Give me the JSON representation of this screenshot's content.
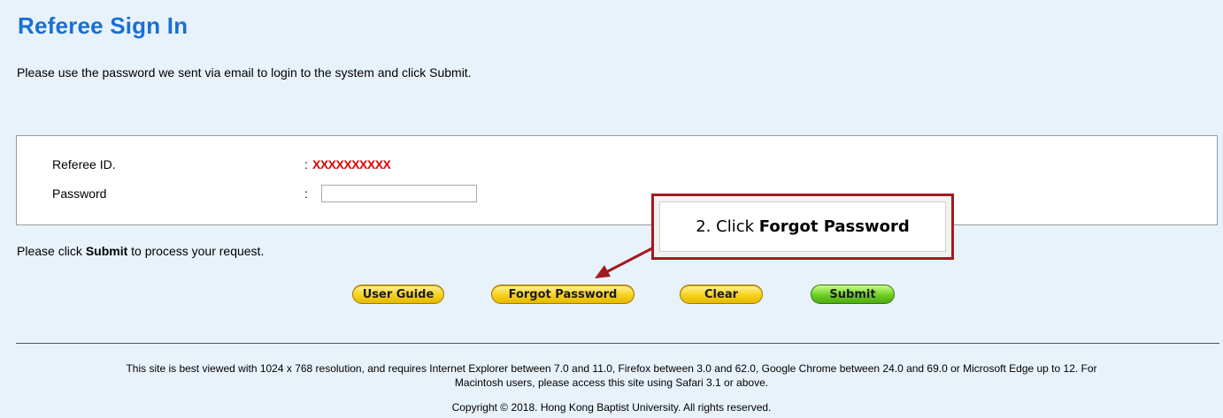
{
  "header": {
    "title": "Referee Sign In"
  },
  "intro_text": "Please use the password we sent via email to login to the system and click Submit.",
  "form": {
    "referee_id_label": "Referee ID.",
    "referee_id_value": "XXXXXXXXXX",
    "password_label": "Password",
    "colon": ":",
    "password_value": ""
  },
  "note": {
    "prefix": "Please click ",
    "strong": "Submit",
    "suffix": " to process your request."
  },
  "buttons": {
    "user_guide": "User Guide",
    "forgot_password": "Forgot Password",
    "clear": "Clear",
    "submit": "Submit"
  },
  "footer": {
    "line1": "This site is best viewed with 1024 x 768 resolution, and requires Internet Explorer between 7.0 and 11.0, Firefox between 3.0 and 62.0, Google Chrome between 24.0 and 69.0 or Microsoft Edge up to 12. For",
    "line2": "Macintosh users, please access this site using Safari 3.1 or above.",
    "copyright": "Copyright © 2018. Hong Kong Baptist University. All rights reserved."
  },
  "callout": {
    "prefix": "2. Click ",
    "strong": "Forgot Password"
  },
  "colors": {
    "title": "#1a6fd6",
    "callout_border": "#a01b20",
    "masked_id": "#e10000"
  }
}
